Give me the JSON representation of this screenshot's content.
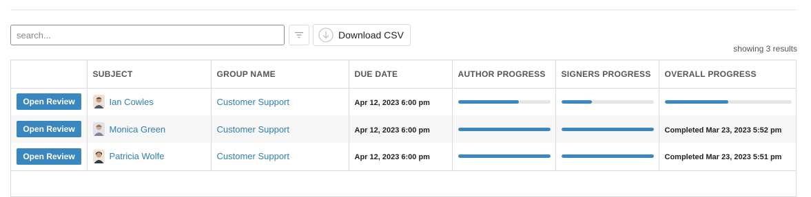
{
  "search": {
    "placeholder": "search...",
    "value": ""
  },
  "toolbar": {
    "download_label": "Download CSV"
  },
  "results_text": "showing 3 results",
  "columns": [
    "",
    "SUBJECT",
    "GROUP NAME",
    "DUE DATE",
    "AUTHOR PROGRESS",
    "SIGNERS PROGRESS",
    "OVERALL PROGRESS"
  ],
  "rows": [
    {
      "action_label": "Open Review",
      "subject": "Ian Cowles",
      "group": "Customer Support",
      "due": "Apr 12, 2023 6:00 pm",
      "author_progress": 0.66,
      "signers_progress": 0.33,
      "overall_progress": 0.5,
      "overall_text": ""
    },
    {
      "action_label": "Open Review",
      "subject": "Monica Green",
      "group": "Customer Support",
      "due": "Apr 12, 2023 6:00 pm",
      "author_progress": 1.0,
      "signers_progress": 1.0,
      "overall_progress": 1.0,
      "overall_text": "Completed Mar 23, 2023 5:52 pm"
    },
    {
      "action_label": "Open Review",
      "subject": "Patricia Wolfe",
      "group": "Customer Support",
      "due": "Apr 12, 2023 6:00 pm",
      "author_progress": 1.0,
      "signers_progress": 1.0,
      "overall_progress": 1.0,
      "overall_text": "Completed Mar 23, 2023 5:51 pm"
    }
  ],
  "colors": {
    "accent": "#3a86be",
    "link": "#2f7fb5",
    "track": "#e5e5e5"
  },
  "icons": {
    "filter": "filter-icon",
    "download": "download-icon",
    "avatar": "avatar-icon"
  }
}
